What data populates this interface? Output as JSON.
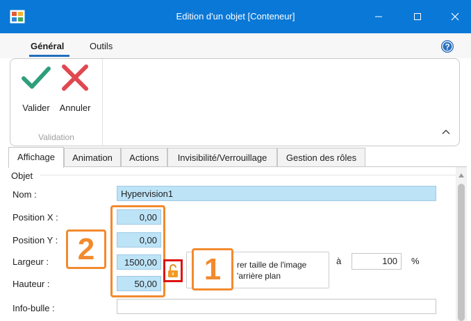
{
  "window": {
    "title": "Edition d'un objet [Conteneur]"
  },
  "ribbon": {
    "tabs": [
      {
        "label": "Général"
      },
      {
        "label": "Outils"
      }
    ],
    "buttons": {
      "valider": "Valider",
      "annuler": "Annuler"
    },
    "group_label": "Validation"
  },
  "tabs": [
    {
      "label": "Affichage"
    },
    {
      "label": "Animation"
    },
    {
      "label": "Actions"
    },
    {
      "label": "Invisibilité/Verrouillage"
    },
    {
      "label": "Gestion des rôles"
    }
  ],
  "form": {
    "group_title": "Objet",
    "nom": {
      "label": "Nom :",
      "value": "Hypervision1"
    },
    "position_x": {
      "label": "Position X :",
      "value": "0,00"
    },
    "position_y": {
      "label": "Position Y :",
      "value": "0,00"
    },
    "largeur": {
      "label": "Largeur :",
      "value": "1500,00"
    },
    "hauteur": {
      "label": "Hauteur :",
      "value": "50,00"
    },
    "infobulle": {
      "label": "Info-bulle :",
      "value": ""
    },
    "image_button": {
      "line1": "rer taille de l'image",
      "line2": "'arrière plan"
    },
    "scale": {
      "prefix": "à",
      "value": "100",
      "unit": "%"
    }
  },
  "annotations": {
    "callout_1": "1",
    "callout_2": "2"
  },
  "colors": {
    "titlebar": "#0a78d7",
    "accent": "#1f6fbf",
    "annotation": "#f28a2e",
    "highlight": "#e01010",
    "field_fill": "#bde3f7",
    "valider": "#2e9e7b",
    "annuler": "#e0484f"
  }
}
